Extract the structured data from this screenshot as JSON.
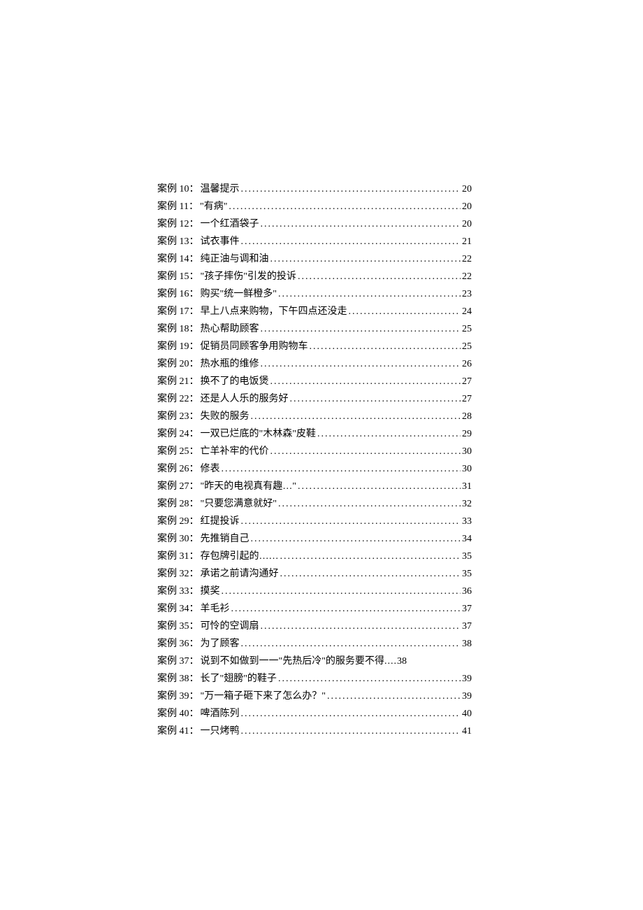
{
  "toc": [
    {
      "label": "案例 10：",
      "title": "温馨提示",
      "page": "20",
      "leader": "dots"
    },
    {
      "label": "案例 11：",
      "title": "\"有病\"",
      "page": "20",
      "leader": "dots"
    },
    {
      "label": "案例 12：",
      "title": " 一个红酒袋子",
      "page": "20",
      "leader": "dots"
    },
    {
      "label": "案例 13：",
      "title": "试衣事件",
      "page": "21",
      "leader": "dots"
    },
    {
      "label": "案例 14：",
      "title": "纯正油与调和油",
      "page": "22",
      "leader": "dots"
    },
    {
      "label": "案例 15：",
      "title": " \"孩子摔伤\"引发的投诉",
      "page": "22",
      "leader": "dots"
    },
    {
      "label": "案例 16：",
      "title": "购买\"统一鲜橙多\"",
      "page": "23",
      "leader": "dots"
    },
    {
      "label": "案例 17：",
      "title": "早上八点来购物，下午四点还没走",
      "page": "24",
      "leader": "dots"
    },
    {
      "label": "案例 18：",
      "title": "热心帮助顾客",
      "page": "25",
      "leader": "dots"
    },
    {
      "label": "案例 19：",
      "title": "促销员同顾客争用购物车",
      "page": "25",
      "leader": "dots"
    },
    {
      "label": "案例 20：",
      "title": "热水瓶的维修",
      "page": "26",
      "leader": "dots"
    },
    {
      "label": "案例 21：",
      "title": "换不了的电饭煲",
      "page": "27",
      "leader": "dots"
    },
    {
      "label": "案例 22：",
      "title": "还是人人乐的服务好",
      "page": "27",
      "leader": "dots"
    },
    {
      "label": "案例 23：",
      "title": "失败的服务",
      "page": "28",
      "leader": "dots"
    },
    {
      "label": "案例 24：",
      "title": " 一双已烂底的\"木林森\"皮鞋",
      "page": "29",
      "leader": "dots"
    },
    {
      "label": "案例 25：",
      "title": "亡羊补牢的代价",
      "page": "30",
      "leader": "dots"
    },
    {
      "label": "案例 26：",
      "title": "修表",
      "page": "30",
      "leader": "dots"
    },
    {
      "label": "案例 27：",
      "title": " \"昨天的电视真有趣…\"",
      "page": "31",
      "leader": "dots"
    },
    {
      "label": "案例 28：",
      "title": " \"只要您满意就好\"",
      "page": "32",
      "leader": "dots"
    },
    {
      "label": "案例 29：",
      "title": "红提投诉",
      "page": "33",
      "leader": "dots"
    },
    {
      "label": "案例 30：",
      "title": "先推销自己",
      "page": "34",
      "leader": "dots"
    },
    {
      "label": "案例 31：",
      "title": "存包牌引起的……",
      "page": "35",
      "leader": "dots"
    },
    {
      "label": "案例 32：",
      "title": "承诺之前请沟通好",
      "page": "35",
      "leader": "dots"
    },
    {
      "label": "案例 33：",
      "title": "摸奖",
      "page": "36",
      "leader": "dots"
    },
    {
      "label": "案例 34：",
      "title": "羊毛衫",
      "page": "37",
      "leader": "dots"
    },
    {
      "label": "案例 35：",
      "title": "可怜的空调扇",
      "page": "37",
      "leader": "dots"
    },
    {
      "label": "案例 36：",
      "title": "为了顾客",
      "page": "38",
      "leader": "dots"
    },
    {
      "label": "案例 37：",
      "title": "说到不如做到一一\"先热后冷\"的服务要不得",
      "page": "38",
      "leader": "short"
    },
    {
      "label": "案例 38：",
      "title": "长了\"翅膀\"的鞋子",
      "page": "39",
      "leader": "dots"
    },
    {
      "label": "案例 39：",
      "title": " \"万一箱子砸下来了怎么办？\"",
      "page": "39",
      "leader": "dots"
    },
    {
      "label": "案例 40：",
      "title": "啤酒陈列",
      "page": "40",
      "leader": "dots"
    },
    {
      "label": "案例 41：",
      "title": " 一只烤鸭",
      "page": "41",
      "leader": "dots"
    }
  ]
}
